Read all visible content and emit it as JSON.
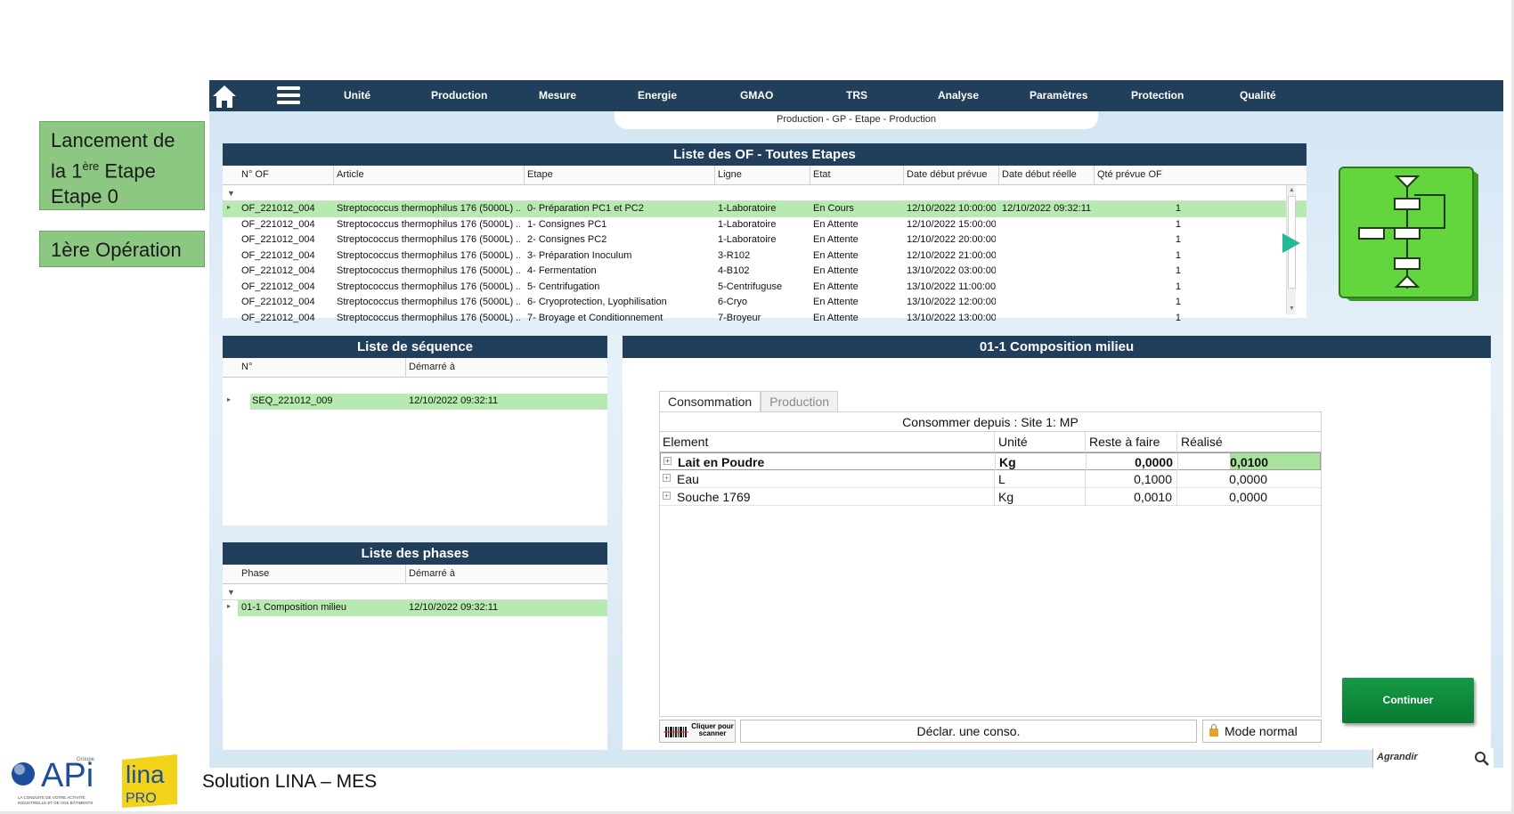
{
  "callouts": {
    "launch_line1": "Lancement de",
    "launch_line2_pre": "la 1",
    "launch_line2_sup": "ère",
    "launch_line2_post": " Etape",
    "launch_line3": "Etape 0",
    "first_operation": "1ère Opération"
  },
  "nav": {
    "items": [
      "Unité",
      "Production",
      "Mesure",
      "Energie",
      "GMAO",
      "TRS",
      "Analyse",
      "Paramètres",
      "Protection",
      "Qualité"
    ],
    "breadcrumb": "Production - GP - Etape - Production"
  },
  "of_list": {
    "title": "Liste des OF - Toutes Etapes",
    "columns": [
      "N° OF",
      "Article",
      "Etape",
      "Ligne",
      "Etat",
      "Date début prévue",
      "Date début réelle",
      "Qté prévue OF"
    ],
    "rows": [
      {
        "of": "OF_221012_004",
        "article": "Streptococcus thermophilus 176 (5000L) ...",
        "etape": "0- Préparation PC1 et PC2",
        "ligne": "1-Laboratoire",
        "etat": "En Cours",
        "debut_prevue": "12/10/2022 10:00:00",
        "debut_reelle": "12/10/2022 09:32:11",
        "qte": "1"
      },
      {
        "of": "OF_221012_004",
        "article": "Streptococcus thermophilus 176 (5000L) ...",
        "etape": "1- Consignes PC1",
        "ligne": "1-Laboratoire",
        "etat": "En Attente",
        "debut_prevue": "12/10/2022 15:00:00",
        "debut_reelle": "",
        "qte": "1"
      },
      {
        "of": "OF_221012_004",
        "article": "Streptococcus thermophilus 176 (5000L) ...",
        "etape": "2- Consignes PC2",
        "ligne": "1-Laboratoire",
        "etat": "En Attente",
        "debut_prevue": "12/10/2022 20:00:00",
        "debut_reelle": "",
        "qte": "1"
      },
      {
        "of": "OF_221012_004",
        "article": "Streptococcus thermophilus 176 (5000L) ...",
        "etape": "3- Préparation Inoculum",
        "ligne": "3-R102",
        "etat": "En Attente",
        "debut_prevue": "12/10/2022 21:00:00",
        "debut_reelle": "",
        "qte": "1"
      },
      {
        "of": "OF_221012_004",
        "article": "Streptococcus thermophilus 176 (5000L) ...",
        "etape": "4- Fermentation",
        "ligne": "4-B102",
        "etat": "En Attente",
        "debut_prevue": "13/10/2022 03:00:00",
        "debut_reelle": "",
        "qte": "1"
      },
      {
        "of": "OF_221012_004",
        "article": "Streptococcus thermophilus 176 (5000L) ...",
        "etape": "5- Centrifugation",
        "ligne": "5-Centrifuguse",
        "etat": "En Attente",
        "debut_prevue": "13/10/2022 11:00:00",
        "debut_reelle": "",
        "qte": "1"
      },
      {
        "of": "OF_221012_004",
        "article": "Streptococcus thermophilus 176 (5000L) ...",
        "etape": "6- Cryoprotection, Lyophilisation",
        "ligne": "6-Cryo",
        "etat": "En Attente",
        "debut_prevue": "13/10/2022 12:00:00",
        "debut_reelle": "",
        "qte": "1"
      },
      {
        "of": "OF_221012_004",
        "article": "Streptococcus thermophilus 176 (5000L) ...",
        "etape": "7- Broyage et Conditionnement",
        "ligne": "7-Broyeur",
        "etat": "En Attente",
        "debut_prevue": "13/10/2022 13:00:00",
        "debut_reelle": "",
        "qte": "1"
      }
    ]
  },
  "sequence": {
    "title": "Liste de séquence",
    "columns": [
      "N°",
      "Démarré à"
    ],
    "rows": [
      {
        "num": "SEQ_221012_009",
        "started": "12/10/2022 09:32:11"
      }
    ]
  },
  "phases": {
    "title": "Liste des phases",
    "columns": [
      "Phase",
      "Démarré à"
    ],
    "rows": [
      {
        "phase": "01-1 Composition milieu",
        "started": "12/10/2022 09:32:11"
      }
    ]
  },
  "composition": {
    "title": "01-1 Composition milieu",
    "tabs": [
      "Consommation",
      "Production"
    ],
    "active_tab": "Consommation",
    "source": "Consommer depuis : Site 1: MP",
    "columns": [
      "Element",
      "Unité",
      "Reste à faire",
      "Réalisé"
    ],
    "rows": [
      {
        "element": "Lait en Poudre",
        "unit": "Kg",
        "remaining": "0,0000",
        "done": "0,0100"
      },
      {
        "element": "Eau",
        "unit": "L",
        "remaining": "0,1000",
        "done": "0,0000"
      },
      {
        "element": "Souche 1769",
        "unit": "Kg",
        "remaining": "0,0010",
        "done": "0,0000"
      }
    ],
    "scan_label": "Cliquer pour scanner",
    "declare_label": "Déclar. une conso.",
    "mode_label": "Mode normal"
  },
  "actions": {
    "continue_label": "Continuer",
    "zoom_label": "Agrandir"
  },
  "footer": {
    "api_brand": "APi",
    "api_group": "Groupe",
    "api_tagline_1": "LA CONDUITE DE VOTRE ACTIVITÉ",
    "api_tagline_2": "INDUSTRIELLE ET DE VOS BÂTIMENTS",
    "lina_brand": "lina",
    "lina_pro": "PRO",
    "solution_text": "Solution LINA – MES"
  },
  "colors": {
    "nav_bg": "#213f5b",
    "selected_row": "#b7eab0",
    "continue_btn": "#0f8a3c",
    "flow_tile": "#5fd23a",
    "callout_bg": "#8dc882"
  }
}
